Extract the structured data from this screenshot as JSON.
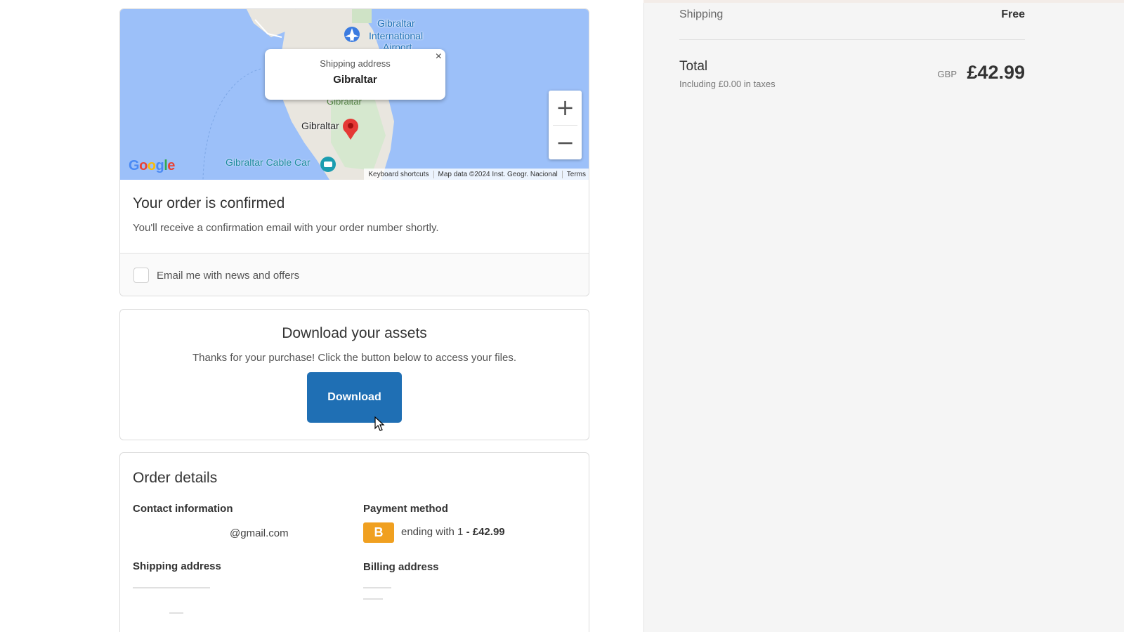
{
  "map": {
    "popup_label": "Shipping address",
    "popup_value": "Gibraltar",
    "popup_close": "×",
    "labels": {
      "airport_1": "Gibraltar",
      "airport_2": "International",
      "airport_3": "Airport",
      "town": "Gibraltar",
      "town_top": "Gibraltar",
      "cable_car": "Gibraltar Cable Car"
    },
    "zoom_in": "+",
    "zoom_out": "−",
    "google": "Google",
    "attribution": {
      "shortcuts": "Keyboard shortcuts",
      "data": "Map data ©2024 Inst. Geogr. Nacional",
      "terms": "Terms"
    }
  },
  "confirmation": {
    "title": "Your order is confirmed",
    "text": "You'll receive a confirmation email with your order number shortly.",
    "newsletter_label": "Email me with news and offers"
  },
  "download": {
    "title": "Download your assets",
    "text": "Thanks for your purchase! Click the button below to access your files.",
    "button": "Download"
  },
  "order_details": {
    "title": "Order details",
    "contact_title": "Contact information",
    "contact_email": "@gmail.com",
    "payment_title": "Payment method",
    "payment_badge": "B",
    "payment_ending": "ending with 1",
    "payment_amount": "£42.99",
    "shipping_title": "Shipping address",
    "billing_title": "Billing address"
  },
  "summary": {
    "shipping_label": "Shipping",
    "shipping_value": "Free",
    "total_label": "Total",
    "tax_note": "Including £0.00 in taxes",
    "currency": "GBP",
    "total_amount": "£42.99"
  },
  "colors": {
    "accent": "#1f6fb4",
    "badge": "#f0a020",
    "map_water": "#9cc0f9"
  }
}
